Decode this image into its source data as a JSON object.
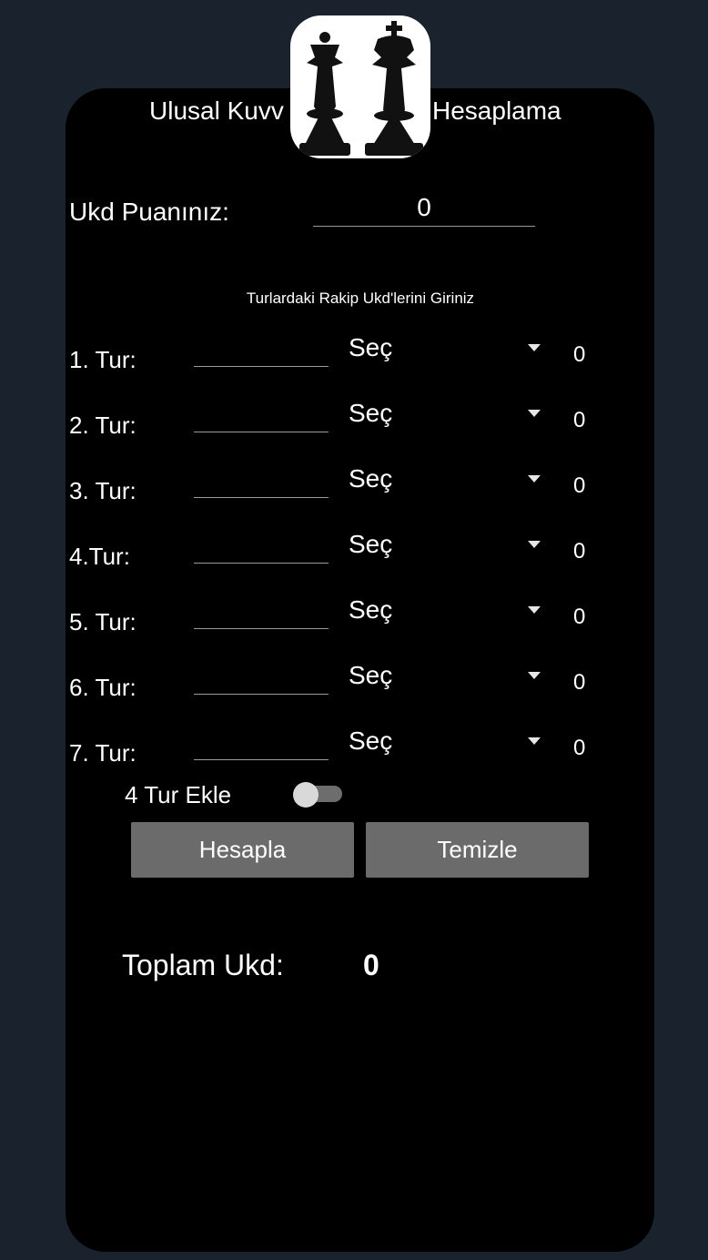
{
  "header": {
    "title_left": "Ulusal Kuvv",
    "title_right": "Hesaplama"
  },
  "ukd": {
    "label": "Ukd Puanınız:",
    "value": "0"
  },
  "subtitle": "Turlardaki Rakip Ukd'lerini Giriniz",
  "rounds": [
    {
      "label": "1. Tur:",
      "select": "Seç",
      "value": "0"
    },
    {
      "label": "2. Tur:",
      "select": "Seç",
      "value": "0"
    },
    {
      "label": "3. Tur:",
      "select": "Seç",
      "value": "0"
    },
    {
      "label": "4.Tur:",
      "select": "Seç",
      "value": "0"
    },
    {
      "label": "5. Tur:",
      "select": "Seç",
      "value": "0"
    },
    {
      "label": "6. Tur:",
      "select": "Seç",
      "value": "0"
    },
    {
      "label": "7. Tur:",
      "select": "Seç",
      "value": "0"
    }
  ],
  "toggle": {
    "label": "4 Tur Ekle",
    "on": false
  },
  "buttons": {
    "calculate": "Hesapla",
    "clear": "Temizle"
  },
  "total": {
    "label": "Toplam Ukd:",
    "value": "0"
  },
  "colors": {
    "background": "#1a232d",
    "card": "#000000",
    "button": "#6b6b6b"
  },
  "icons": {
    "logo": "chess-queen-king-icon",
    "dropdown": "caret-down-icon"
  }
}
